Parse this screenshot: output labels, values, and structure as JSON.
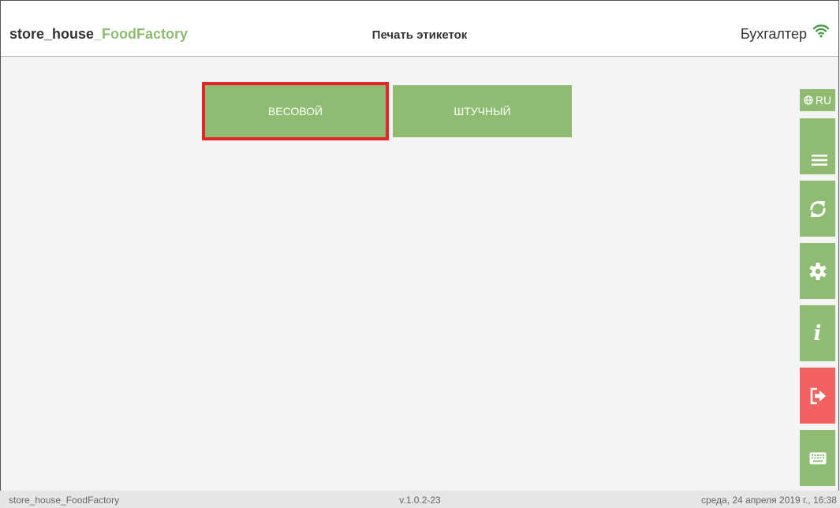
{
  "header": {
    "app_title_main": "store_house",
    "app_title_accent": "_FoodFactory",
    "page_title": "Печать этикеток",
    "user": "Бухгалтер"
  },
  "modes": {
    "weight_label": "ВЕСОВОЙ",
    "piece_label": "ШТУЧНЫЙ"
  },
  "sidebar": {
    "language": "RU",
    "icons": [
      "menu-icon",
      "sync-icon",
      "gear-icon",
      "info-icon",
      "logout-icon",
      "keyboard-icon"
    ],
    "info_glyph": "i"
  },
  "footer": {
    "app_name": "store_house_FoodFactory",
    "version": "v.1.0.2-23",
    "datetime": "среда, 24 апреля 2019 г., 16:38"
  },
  "colors": {
    "accent": "#8fbc72",
    "danger": "#f36060",
    "highlight": "#e3262a"
  }
}
